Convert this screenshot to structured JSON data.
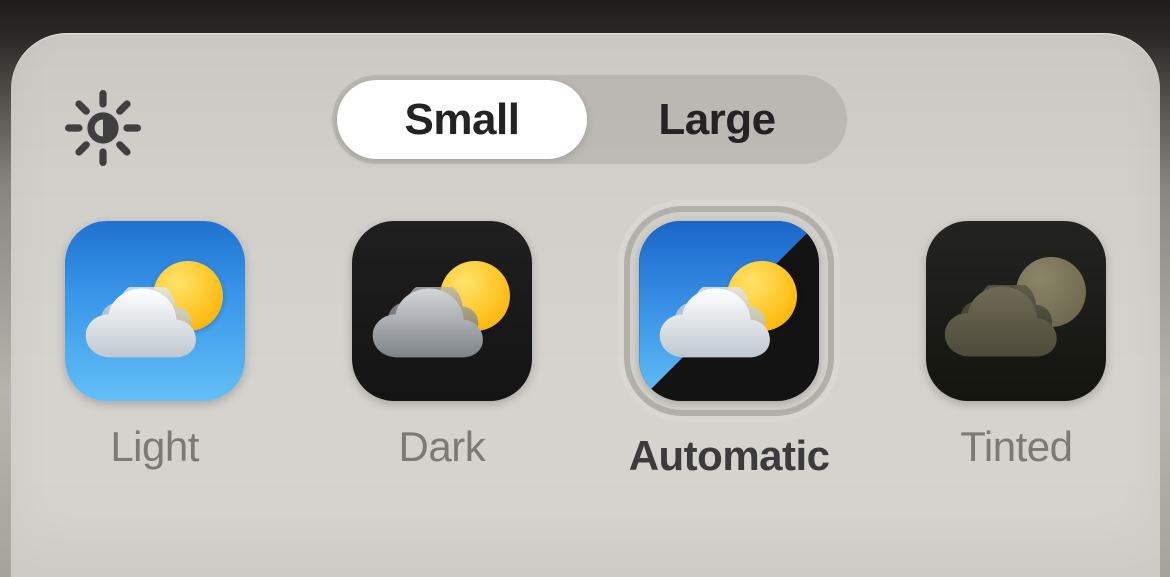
{
  "segmented": {
    "options": [
      "Small",
      "Large"
    ],
    "selected": 0
  },
  "appearance_options": [
    {
      "id": "light",
      "label": "Light",
      "selected": false
    },
    {
      "id": "dark",
      "label": "Dark",
      "selected": false
    },
    {
      "id": "automatic",
      "label": "Automatic",
      "selected": true
    },
    {
      "id": "tinted",
      "label": "Tinted",
      "selected": false
    }
  ]
}
